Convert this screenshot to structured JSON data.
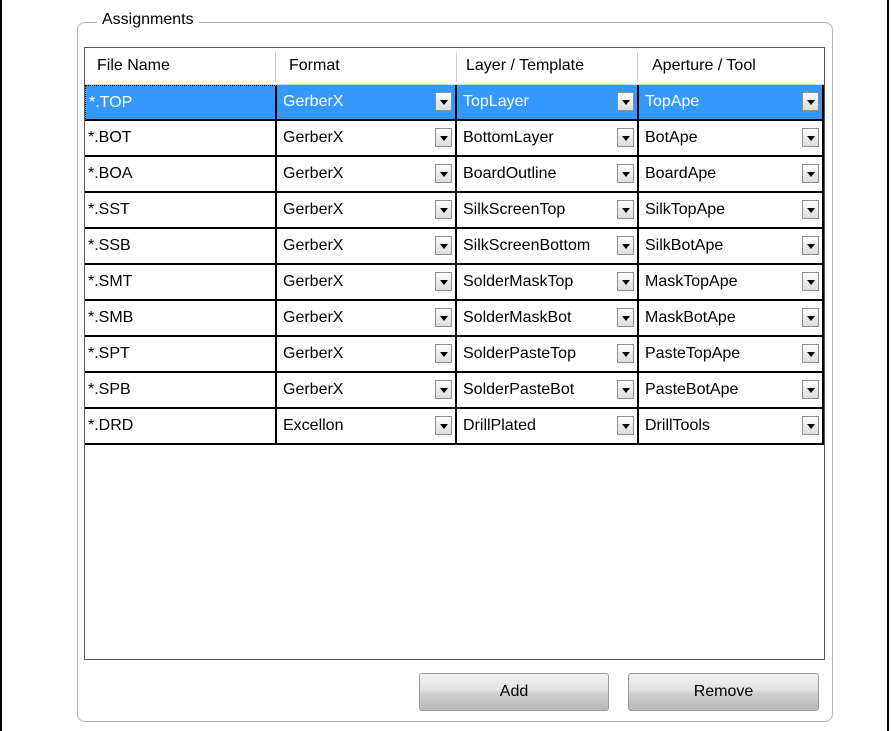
{
  "assignments": {
    "title": "Assignments",
    "columns": [
      "File Name",
      "Format",
      "Layer / Template",
      "Aperture / Tool"
    ],
    "selected_row": 0,
    "rows": [
      {
        "file": "*.TOP",
        "format": "GerberX",
        "layer": "TopLayer",
        "aperture": "TopApe"
      },
      {
        "file": "*.BOT",
        "format": "GerberX",
        "layer": "BottomLayer",
        "aperture": "BotApe"
      },
      {
        "file": "*.BOA",
        "format": "GerberX",
        "layer": "BoardOutline",
        "aperture": "BoardApe"
      },
      {
        "file": "*.SST",
        "format": "GerberX",
        "layer": "SilkScreenTop",
        "aperture": "SilkTopApe"
      },
      {
        "file": "*.SSB",
        "format": "GerberX",
        "layer": "SilkScreenBottom",
        "aperture": "SilkBotApe"
      },
      {
        "file": "*.SMT",
        "format": "GerberX",
        "layer": "SolderMaskTop",
        "aperture": "MaskTopApe"
      },
      {
        "file": "*.SMB",
        "format": "GerberX",
        "layer": "SolderMaskBot",
        "aperture": "MaskBotApe"
      },
      {
        "file": "*.SPT",
        "format": "GerberX",
        "layer": "SolderPasteTop",
        "aperture": "PasteTopApe"
      },
      {
        "file": "*.SPB",
        "format": "GerberX",
        "layer": "SolderPasteBot",
        "aperture": "PasteBotApe"
      },
      {
        "file": "*.DRD",
        "format": "Excellon",
        "layer": "DrillPlated",
        "aperture": "DrillTools"
      }
    ],
    "buttons": {
      "add": "Add",
      "remove": "Remove"
    }
  },
  "colors": {
    "selection": "#3399ff",
    "grid_line": "#000000"
  }
}
